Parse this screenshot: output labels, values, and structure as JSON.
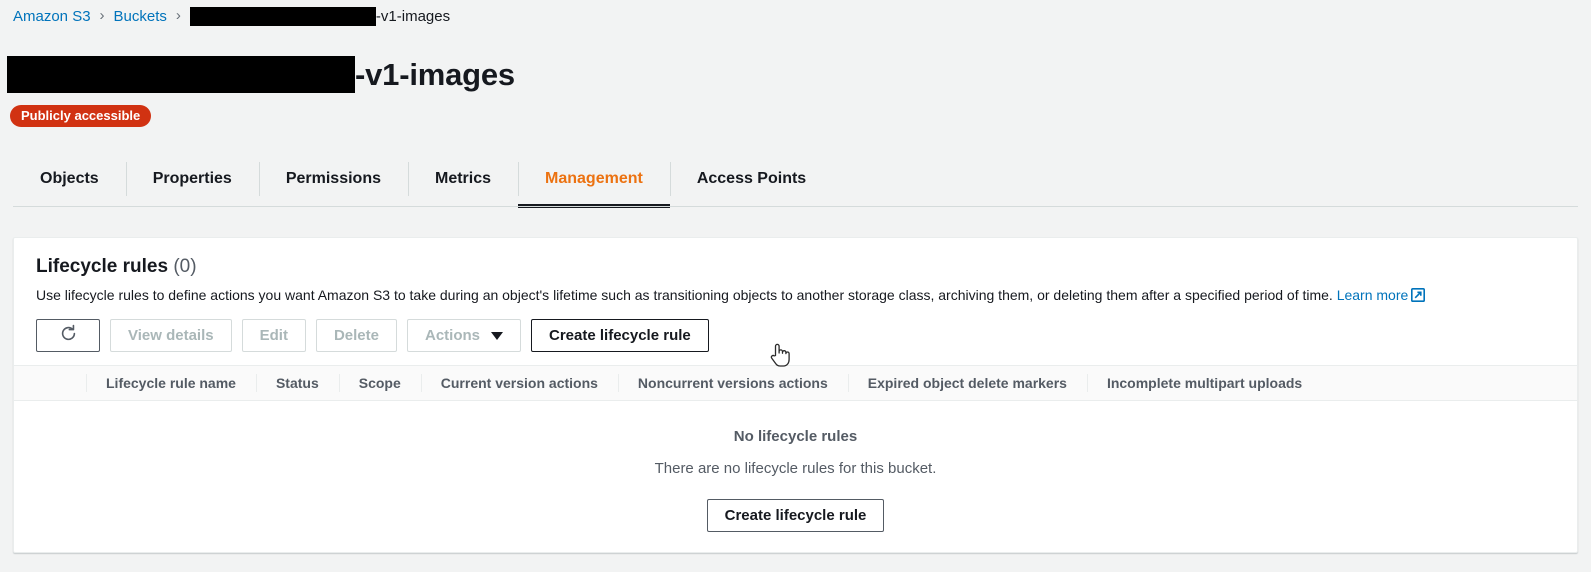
{
  "breadcrumb": {
    "items": [
      {
        "label": "Amazon S3",
        "type": "link"
      },
      {
        "label": "Buckets",
        "type": "link"
      },
      {
        "label": "-v1-images",
        "type": "current",
        "redacted": true
      }
    ],
    "separator": "›"
  },
  "header": {
    "title_suffix": "-v1-images",
    "title_redacted": true,
    "badge": "Publicly accessible",
    "badge_color": "#d13212"
  },
  "tabs": {
    "active": "Management",
    "active_color": "#ec7211",
    "items": [
      {
        "label": "Objects"
      },
      {
        "label": "Properties"
      },
      {
        "label": "Permissions"
      },
      {
        "label": "Metrics"
      },
      {
        "label": "Management"
      },
      {
        "label": "Access Points"
      }
    ]
  },
  "card": {
    "title": "Lifecycle rules",
    "count": "(0)",
    "description": "Use lifecycle rules to define actions you want Amazon S3 to take during an object's lifetime such as transitioning objects to another storage class, archiving them, or deleting them after a specified period of time.",
    "learn_more": "Learn more",
    "learn_more_color": "#0073bb"
  },
  "toolbar": {
    "refresh_icon": "refresh-icon",
    "buttons": [
      {
        "label": "View details",
        "disabled": true
      },
      {
        "label": "Edit",
        "disabled": true
      },
      {
        "label": "Delete",
        "disabled": true
      },
      {
        "label": "Actions",
        "disabled": true,
        "caret": true
      }
    ],
    "create_label": "Create lifecycle rule"
  },
  "table": {
    "columns": [
      "Lifecycle rule name",
      "Status",
      "Scope",
      "Current version actions",
      "Noncurrent versions actions",
      "Expired object delete markers",
      "Incomplete multipart uploads"
    ]
  },
  "empty_state": {
    "title": "No lifecycle rules",
    "subtitle": "There are no lifecycle rules for this bucket.",
    "button": "Create lifecycle rule"
  }
}
